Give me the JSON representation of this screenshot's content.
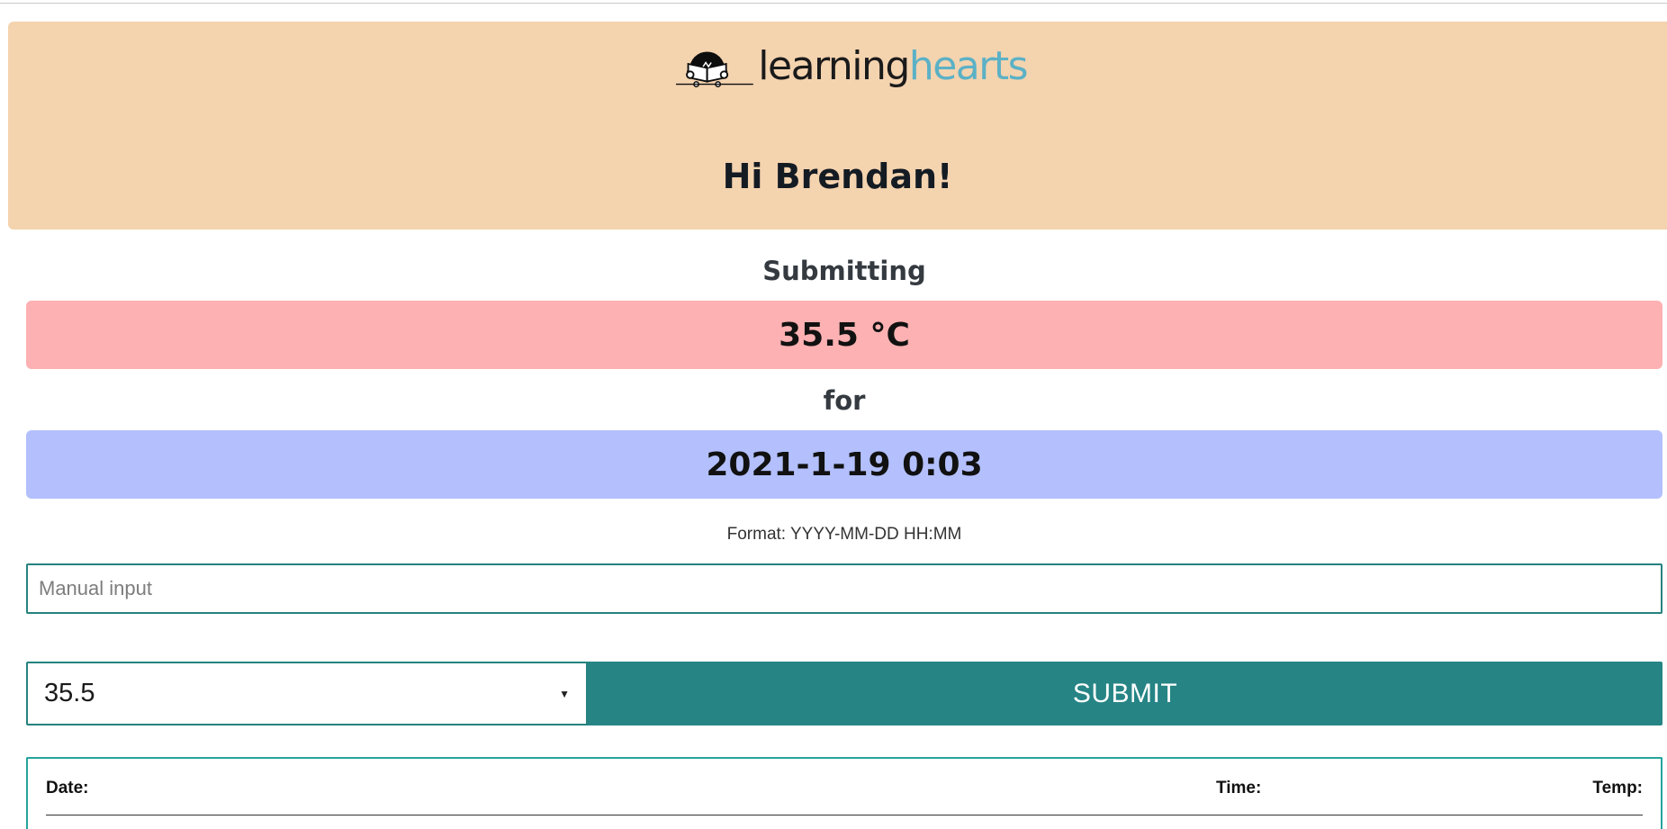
{
  "header": {
    "logo_text_learning": "learning",
    "logo_text_hearts": "hearts",
    "greeting": "Hi Brendan!",
    "brand_color": "#f4d3af",
    "logo_accent_color": "#5bb1c6"
  },
  "summary": {
    "submitting_label": "Submitting",
    "temperature_display": "35.5 °C",
    "for_label": "for",
    "datetime_display": "2021-1-19 0:03",
    "temperature_bar_color": "#fdb1b2",
    "datetime_bar_color": "#b3c0fd"
  },
  "form": {
    "format_hint": "Format: YYYY-MM-DD HH:MM",
    "manual_input_placeholder": "Manual input",
    "manual_input_value": "",
    "temperature_select_value": "35.5",
    "submit_label": "SUBMIT",
    "accent_color": "#268485"
  },
  "history": {
    "columns": [
      "Date:",
      "Time:",
      "Temp:"
    ]
  }
}
